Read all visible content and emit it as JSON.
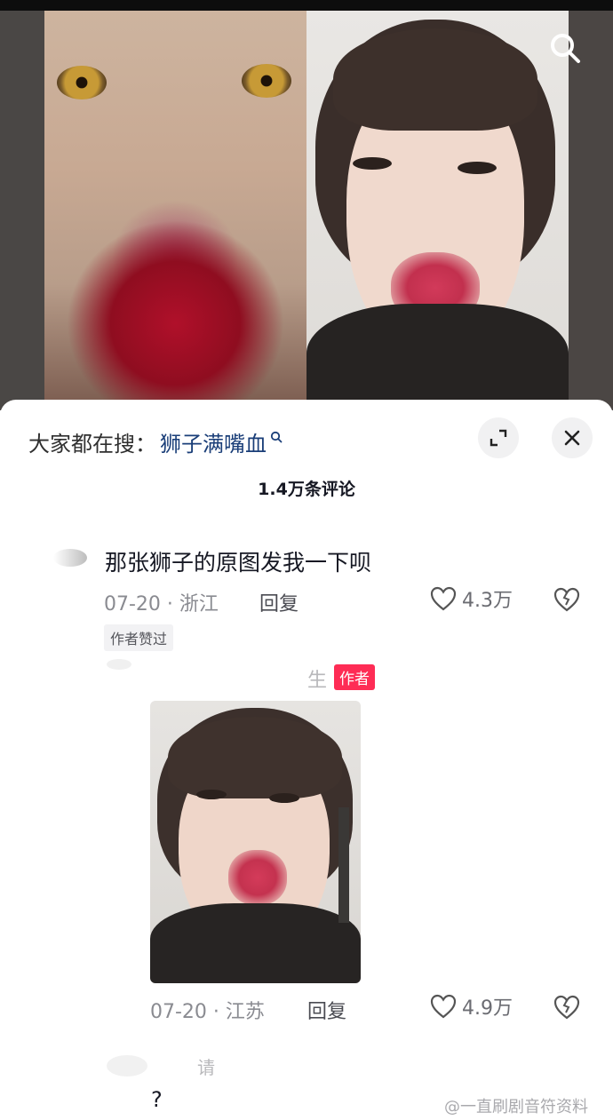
{
  "hot_search": {
    "label": "大家都在搜：",
    "keyword": "狮子满嘴血"
  },
  "header": {
    "comment_count": "1.4万条评论"
  },
  "comments": [
    {
      "text": "那张狮子的原图发我一下呗",
      "date_location": "07-20 · 浙江",
      "reply_label": "回复",
      "likes": "4.3万",
      "badge": "作者赞过"
    }
  ],
  "reply": {
    "username_partial": "生",
    "author_badge": "作者",
    "date_location": "07-20 · 江苏",
    "reply_label": "回复",
    "likes": "4.9万"
  },
  "third_comment": {
    "username_partial": "请",
    "text": "?"
  },
  "watermark": "@一直刷剧音符资料",
  "colors": {
    "author_badge_bg": "#fe2c55",
    "keyword_color": "#1a3e78",
    "meta_gray": "#8a8b91"
  },
  "icons": [
    "search-icon",
    "expand-icon",
    "close-icon",
    "heart-icon",
    "broken-heart-icon",
    "magnifier-small-icon"
  ]
}
